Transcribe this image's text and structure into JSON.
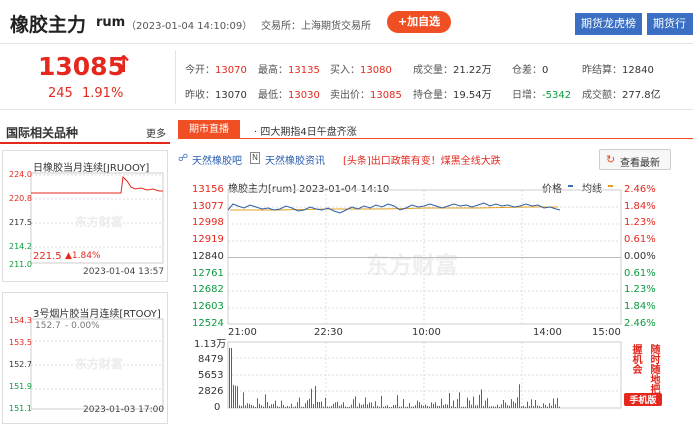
{
  "header": {
    "name": "橡胶主力",
    "code": "rum",
    "datetime": "（2023-01-04 14:10:09）",
    "exchange": "交易所：上海期货交易所",
    "add_label": "+加自选",
    "btn1": "期货龙虎榜",
    "btn2": "期货行"
  },
  "quote": {
    "price": "13085",
    "arrow": "↑",
    "change": "245",
    "pct": "1.91%"
  },
  "stats": [
    [
      {
        "l": "今开：",
        "v": "13070",
        "c": "red"
      },
      {
        "l": "最高：",
        "v": "13135",
        "c": "red"
      },
      {
        "l": "买入：",
        "v": "13080",
        "c": "red"
      },
      {
        "l": "成交量：",
        "v": "21.22万",
        "c": ""
      },
      {
        "l": "仓差：",
        "v": "0",
        "c": ""
      },
      {
        "l": "昨结算：",
        "v": "12840",
        "c": ""
      }
    ],
    [
      {
        "l": "昨收：",
        "v": "13070",
        "c": ""
      },
      {
        "l": "最低：",
        "v": "13030",
        "c": "red"
      },
      {
        "l": "卖出价：",
        "v": "13085",
        "c": "red"
      },
      {
        "l": "持仓量：",
        "v": "19.54万",
        "c": ""
      },
      {
        "l": "日增：",
        "v": "-5342",
        "c": "green"
      },
      {
        "l": "成交额：",
        "v": "277.8亿",
        "c": ""
      }
    ]
  ],
  "sidebar": {
    "title": "国际相关品种",
    "more": "更多",
    "card1": {
      "title": "日橡胶当月连续[JRUOOY]",
      "y": [
        "224.0",
        "220.8",
        "217.5",
        "214.2",
        "211.0"
      ],
      "price": "221.5",
      "chg": "▲1.84%",
      "time": "2023-01-04  13:57"
    },
    "card2": {
      "title": "3号烟片胶当月连续[RTOOY]",
      "y": [
        "154.3",
        "153.5",
        "152.7",
        "151.9",
        "151.1"
      ],
      "price": "152.7",
      "chg": "- 0.00%",
      "time": "2023-01-03  17:00"
    },
    "watermark": "东方财富"
  },
  "tabs": {
    "active": "期市直播",
    "news": "· 四大期指4日午盘齐涨"
  },
  "links": {
    "l1": "天然橡胶吧",
    "l2": "天然橡胶资讯",
    "headline": "[头条]出口政策有变！煤黑全线大跌",
    "refresh": "查看最新"
  },
  "chart": {
    "title": "橡胶主力[rum]  2023-01-04 14:10",
    "legend_price": "价格",
    "legend_avg": "均线",
    "watermark": "东方财富",
    "left_ticks": [
      "13156",
      "13077",
      "12998",
      "12919",
      "12840",
      "12761",
      "12682",
      "12603",
      "12524"
    ],
    "right_ticks": [
      "2.46%",
      "1.84%",
      "1.23%",
      "0.61%",
      "0.00%",
      "0.61%",
      "1.23%",
      "1.84%",
      "2.46%"
    ],
    "x_labels": [
      "21:00",
      "22:30",
      "10:00",
      "14:00",
      "15:00"
    ],
    "vol_ticks": [
      "1.13万",
      "8479",
      "5653",
      "2826",
      "0"
    ],
    "promo": "随时随地把握机会",
    "promo_sub": "手机版"
  }
}
